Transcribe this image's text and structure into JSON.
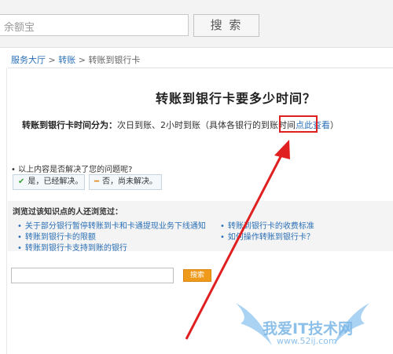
{
  "header": {
    "search_value": "余额宝",
    "search_button": "搜 索"
  },
  "breadcrumb": {
    "items": [
      "服务大厅",
      "转账",
      "转账到银行卡"
    ],
    "separator": ">"
  },
  "article": {
    "title": "转账到银行卡要多少时间？",
    "answer_label": "转账到银行卡时间分为：",
    "answer_text": "次日到账、2小时到账（具体各银行的到账时间",
    "answer_link": "点此查看",
    "answer_tail": "）"
  },
  "feedback": {
    "question": "• 以上内容是否解决了您的问题呢?",
    "yes_label": "是，已经解决。",
    "no_label": "否，尚未解决。"
  },
  "related": {
    "title": "浏览过该知识点的人还浏览过：",
    "links": [
      "关于部分银行暂停转账到卡和卡通提现业务下线通知",
      "转账到银行卡的收费标准",
      "转账到银行卡的限额",
      "如何操作转账到银行卡？",
      "转账到银行卡支持到账的银行"
    ]
  },
  "bottom_search": {
    "value": "",
    "button": "搜索"
  },
  "watermark": {
    "text": "我爱IT技术网",
    "url": "www.52ij.com"
  },
  "colors": {
    "link": "#2a6fb6",
    "highlight": "#e02020",
    "search_button": "#f09a1c"
  }
}
